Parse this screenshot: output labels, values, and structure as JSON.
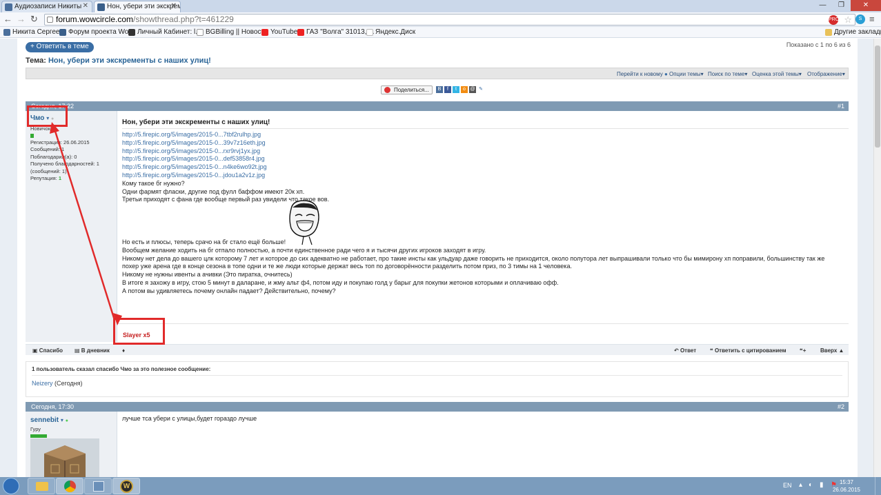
{
  "browser": {
    "tabs": [
      {
        "title": "Аудиозаписи Никиты"
      },
      {
        "title": "Нон, убери эти экскреме"
      }
    ],
    "url_host": "forum.wowcircle.com",
    "url_path": "/showthread.php?t=461229",
    "bookmarks": [
      {
        "label": "Никита Сергеев"
      },
      {
        "label": "Форум проекта Wo..."
      },
      {
        "label": "Личный Кабинет: l..."
      },
      {
        "label": "BGBilling || Новости"
      },
      {
        "label": "YouTube"
      },
      {
        "label": "ГАЗ \"Волга\" 31013, ..."
      },
      {
        "label": "Яндекс.Диск"
      }
    ],
    "other_bookmarks": "Другие закладки"
  },
  "forum": {
    "reply_button": "+ Ответить в теме",
    "shown": "Показано с 1 по 6 из 6",
    "thread_label": "Тема:",
    "thread_title": "Нон, убери эти экскременты с наших улиц!",
    "tools": {
      "go_new": "Перейти к новому",
      "options": "Опции темы",
      "search": "Поиск по теме",
      "rating": "Оценка этой темы",
      "display": "Отображение"
    },
    "share_label": "Поделиться...",
    "post1": {
      "date": "Сегодня, 17:22",
      "number": "#1",
      "author": "Чмо",
      "rank": "Новичок",
      "reg_label": "Регистрация:",
      "reg_date": "26.06.2015",
      "msgs_label": "Сообщений:",
      "msgs": "1",
      "thanked_label": "Поблагодарил(а):",
      "thanked": "0",
      "got_thanks": "Получено благодарностей: 1",
      "got_thanks_msgs": "(сообщений: 1)",
      "rep_label": "Репутация:",
      "rep": "1",
      "title": "Нон, убери эти экскременты с наших улиц!",
      "links": [
        "http://5.firepic.org/5/images/2015-0...7tbf2rulhp.jpg",
        "http://5.firepic.org/5/images/2015-0...39v7z16eth.jpg",
        "http://5.firepic.org/5/images/2015-0...rxr9rvj1yx.jpg",
        "http://5.firepic.org/5/images/2015-0...def53858r4.jpg",
        "http://5.firepic.org/5/images/2015-0...n4ke6wo92t.jpg",
        "http://5.firepic.org/5/images/2015-0...jdou1a2v1z.jpg"
      ],
      "lines_a": [
        "Кому такое бг нужно?",
        "Одни фармят фласки, другие под фулл баффом имеют 20к хп.",
        "Третьи приходят с фана где вообще первый раз увидели что такое вов."
      ],
      "lines_b": [
        "Но есть и плюсы, теперь срачо на бг стало ещё больше!",
        "Вообщем желание ходить на бг отпало полностью, а почти единственное ради чего я и тысячи других игроков заходят в игру.",
        "Никому нет дела до вашего цлк которому 7 лет и которое до сих адекватно не работает, про такие инсты как ульдуар даже говорить не приходится, около полутора лет выпрашивали только что бы мимирону хп поправили, большинству так же",
        "похер уже арена где в конце сезона в топе одни и те же люди которые держат весь топ по договорённости разделить потом приз, по 3 тимы на 1 человека.",
        "Никому не нужны ивенты а ачивки (Это пиратка, очнитесь)",
        "В итоге я захожу в игру, стою 5 минут в даларане, и жму альт ф4, потом иду и покупаю голд у барыг для покупки жетонов которыми и оплачиваю офф.",
        "А потом вы удивляетесь почему онлайн падает? Действительно, почему?"
      ],
      "signature": "Slayer x5",
      "thanks_btn": "Спасибо",
      "diary_btn": "В дневник",
      "answer_btn": "Ответ",
      "quote_btn": "Ответить с цитированием",
      "top_btn": "Вверх"
    },
    "thanks_box": {
      "header": "1 пользователь сказал спасибо Чмо за это полезное сообщение:",
      "user": "Neizery",
      "when": "(Сегодня)"
    },
    "post2": {
      "date": "Сегодня, 17:30",
      "number": "#2",
      "author": "sennebit",
      "rank": "Гуру",
      "text": "лучше тса убери с улицы,будет гораздо лучше"
    }
  },
  "taskbar": {
    "lang": "EN",
    "time": "15:37",
    "date": "26.06.2015"
  },
  "colors": {
    "annotation": "#e12a2a",
    "post_header": "#7f9ab3",
    "link": "#3a6ea5"
  }
}
